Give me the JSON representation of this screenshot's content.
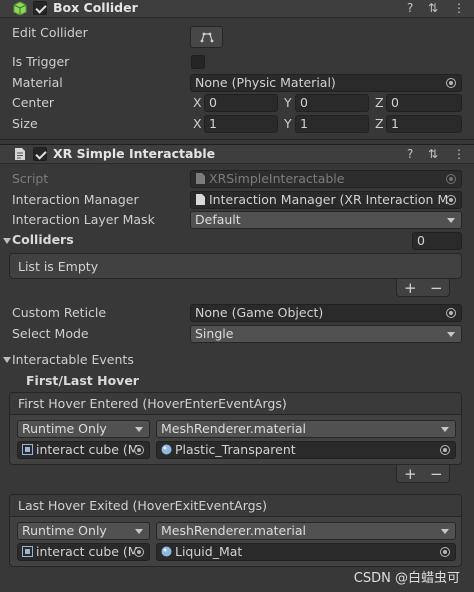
{
  "box_collider": {
    "title": "Box Collider",
    "edit_collider_label": "Edit Collider",
    "is_trigger_label": "Is Trigger",
    "material_label": "Material",
    "material_value": "None (Physic Material)",
    "center_label": "Center",
    "center": {
      "x": "0",
      "y": "0",
      "z": "0"
    },
    "size_label": "Size",
    "size": {
      "x": "1",
      "y": "1",
      "z": "1"
    },
    "axis_x": "X",
    "axis_y": "Y",
    "axis_z": "Z"
  },
  "interactable": {
    "title": "XR Simple Interactable",
    "script_label": "Script",
    "script_value": "XRSimpleInteractable",
    "interaction_manager_label": "Interaction Manager",
    "interaction_manager_value": "Interaction Manager (XR Interaction M",
    "layer_mask_label": "Interaction Layer Mask",
    "layer_mask_value": "Default",
    "colliders_label": "Colliders",
    "colliders_count": "0",
    "list_empty": "List is Empty",
    "custom_reticle_label": "Custom Reticle",
    "custom_reticle_value": "None (Game Object)",
    "select_mode_label": "Select Mode",
    "select_mode_value": "Single",
    "events_label": "Interactable Events",
    "first_last_hover_label": "First/Last Hover",
    "first_hover": {
      "title": "First Hover Entered (HoverEnterEventArgs)",
      "runtime": "Runtime Only",
      "function": "MeshRenderer.material",
      "object": "interact cube (M",
      "argument": "Plastic_Transparent"
    },
    "last_hover": {
      "title": "Last Hover Exited (HoverExitEventArgs)",
      "runtime": "Runtime Only",
      "function": "MeshRenderer.material",
      "object": "interact cube (M",
      "argument": "Liquid_Mat"
    },
    "plus": "+",
    "minus": "−"
  },
  "header_icons": {
    "help": "?",
    "settings": "⇅",
    "menu": "⋮"
  },
  "watermark": "CSDN @白蜡虫可",
  "colors": {
    "background": "#383838",
    "header": "#3e3e3e",
    "field": "#2a2a2a",
    "dropdown": "#515151",
    "cube_green": "#8bd85b"
  }
}
